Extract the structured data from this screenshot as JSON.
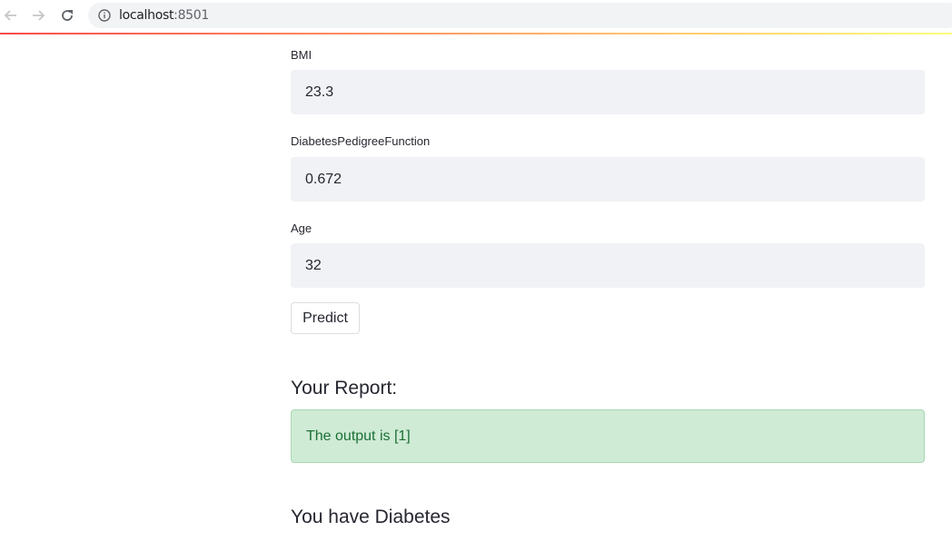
{
  "browser": {
    "url_host": "localhost",
    "url_port": ":8501",
    "icons": {
      "back": "arrow-left-icon",
      "forward": "arrow-right-icon",
      "reload": "reload-icon",
      "info": "info-icon"
    }
  },
  "form": {
    "fields": [
      {
        "label": "BMI",
        "value": "23.3"
      },
      {
        "label": "DiabetesPedigreeFunction",
        "value": "0.672"
      },
      {
        "label": "Age",
        "value": "32"
      }
    ],
    "predict_label": "Predict"
  },
  "report": {
    "heading": "Your Report:",
    "output_text": "The output is [1]",
    "result_text": "You have Diabetes"
  },
  "colors": {
    "accent_gradient_start": "#ff4b4b",
    "accent_gradient_end": "#fffd80",
    "input_background": "#f0f2f6",
    "success_background": "#cfebd6",
    "success_text": "#1c6f35"
  }
}
